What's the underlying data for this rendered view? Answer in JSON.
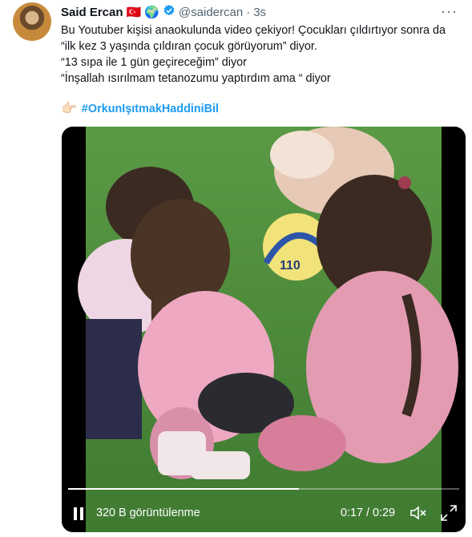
{
  "tweet": {
    "author_name": "Said Ercan",
    "flag": "🇹🇷",
    "globe": "🌍",
    "handle": "@saidercan",
    "separator": "·",
    "time": "3s",
    "lines": [
      "Bu Youtuber kişisi anaokulunda video çekiyor! Çocukları çıldırtıyor sonra da",
      "“ilk kez 3 yaşında çıldıran çocuk görüyorum” diyor.",
      "“13 sıpa ile 1 gün geçireceğim” diyor",
      "“İnşallah ısırılmam tetanozumu yaptırdım ama “ diyor"
    ],
    "hashtag_emoji": "👉🏻",
    "hashtag": "#OrkunIşıtmakHaddiniBil",
    "more": "···"
  },
  "video": {
    "views": "320 B görüntülenme",
    "time_readout": "0:17 / 0:29",
    "progress": 0.59,
    "ball_text": "110"
  },
  "colors": {
    "accent": "#1d9bf0",
    "text": "#0f1419",
    "muted": "#536471",
    "grass": "#4f8a3c",
    "pink": "#e9a7bd"
  }
}
